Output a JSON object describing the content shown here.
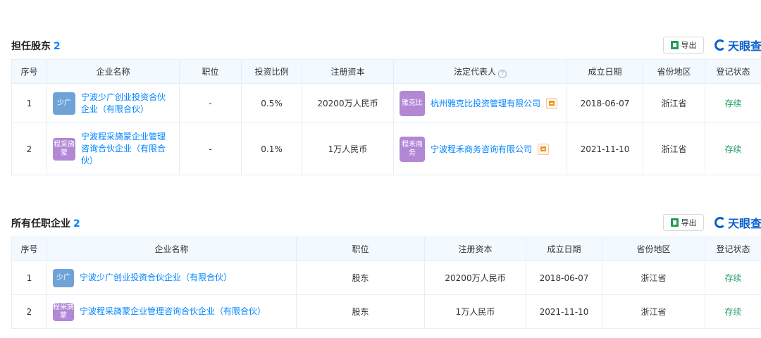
{
  "section1": {
    "title": "担任股东",
    "count": "2",
    "export_label": "导出",
    "brand_text": "天眼查",
    "headers": [
      "序号",
      "企业名称",
      "职位",
      "投资比例",
      "注册资本",
      "法定代表人",
      "成立日期",
      "省份地区",
      "登记状态"
    ],
    "help_icon": "?",
    "rows": [
      {
        "index": "1",
        "logo_text": "少广",
        "logo_color": "#6fa3d8",
        "company": "宁波少广创业投资合伙企业（有限合伙）",
        "position": "-",
        "ratio": "0.5%",
        "capital": "20200万人民币",
        "rep_logo_text": "雅克比",
        "rep_logo_color": "#b287d6",
        "rep_name": "杭州雅克比投资管理有限公司",
        "date": "2018-06-07",
        "region": "浙江省",
        "status": "存续"
      },
      {
        "index": "2",
        "logo_text": "程采旖蒙",
        "logo_color": "#b287d6",
        "company": "宁波程采旖蒙企业管理咨询合伙企业（有限合伙）",
        "position": "-",
        "ratio": "0.1%",
        "capital": "1万人民币",
        "rep_logo_text": "程禾商务",
        "rep_logo_color": "#b287d6",
        "rep_name": "宁波程禾商务咨询有限公司",
        "date": "2021-11-10",
        "region": "浙江省",
        "status": "存续"
      }
    ]
  },
  "section2": {
    "title": "所有任职企业",
    "count": "2",
    "export_label": "导出",
    "brand_text": "天眼查",
    "headers": [
      "序号",
      "企业名称",
      "职位",
      "注册资本",
      "成立日期",
      "省份地区",
      "登记状态"
    ],
    "rows": [
      {
        "index": "1",
        "logo_text": "少广",
        "logo_color": "#6fa3d8",
        "company": "宁波少广创业投资合伙企业（有限合伙）",
        "position": "股东",
        "capital": "20200万人民币",
        "date": "2018-06-07",
        "region": "浙江省",
        "status": "存续"
      },
      {
        "index": "2",
        "logo_text": "程采旖蒙",
        "logo_color": "#b287d6",
        "company": "宁波程采旖蒙企业管理咨询合伙企业（有限合伙）",
        "position": "股东",
        "capital": "1万人民币",
        "date": "2021-11-10",
        "region": "浙江省",
        "status": "存续"
      }
    ]
  },
  "colors": {
    "accent": "#0084ff",
    "status": "#20a162",
    "header_bg": "#f2f9ff"
  },
  "icons": [
    "excel-icon",
    "tianyancha-logo-icon",
    "help-icon",
    "relation-icon"
  ]
}
